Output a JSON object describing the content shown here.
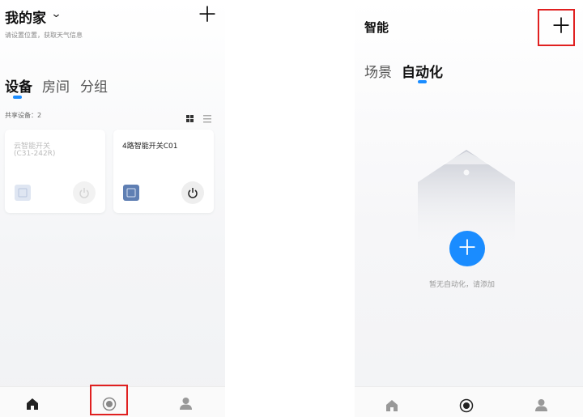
{
  "left": {
    "home_title": "我的家",
    "location_hint": "请设置位置，获取天气信息",
    "tabs": [
      {
        "label": "设备",
        "active": true
      },
      {
        "label": "房间",
        "active": false
      },
      {
        "label": "分组",
        "active": false
      }
    ],
    "shared_label": "共享设备：2",
    "devices": [
      {
        "name": "云智能开关",
        "model": "(C31-242R)",
        "online": false
      },
      {
        "name": "4路智能开关C01",
        "model": "",
        "online": true
      }
    ],
    "nav": [
      "home-icon",
      "smart-icon",
      "profile-icon"
    ]
  },
  "right": {
    "title": "智能",
    "tabs": [
      {
        "label": "场景",
        "active": false
      },
      {
        "label": "自动化",
        "active": true
      }
    ],
    "empty_text": "暂无自动化，请添加",
    "nav": [
      "home-icon",
      "smart-icon",
      "profile-icon"
    ]
  },
  "colors": {
    "accent": "#1a8cff",
    "highlight_box": "#e02020"
  }
}
